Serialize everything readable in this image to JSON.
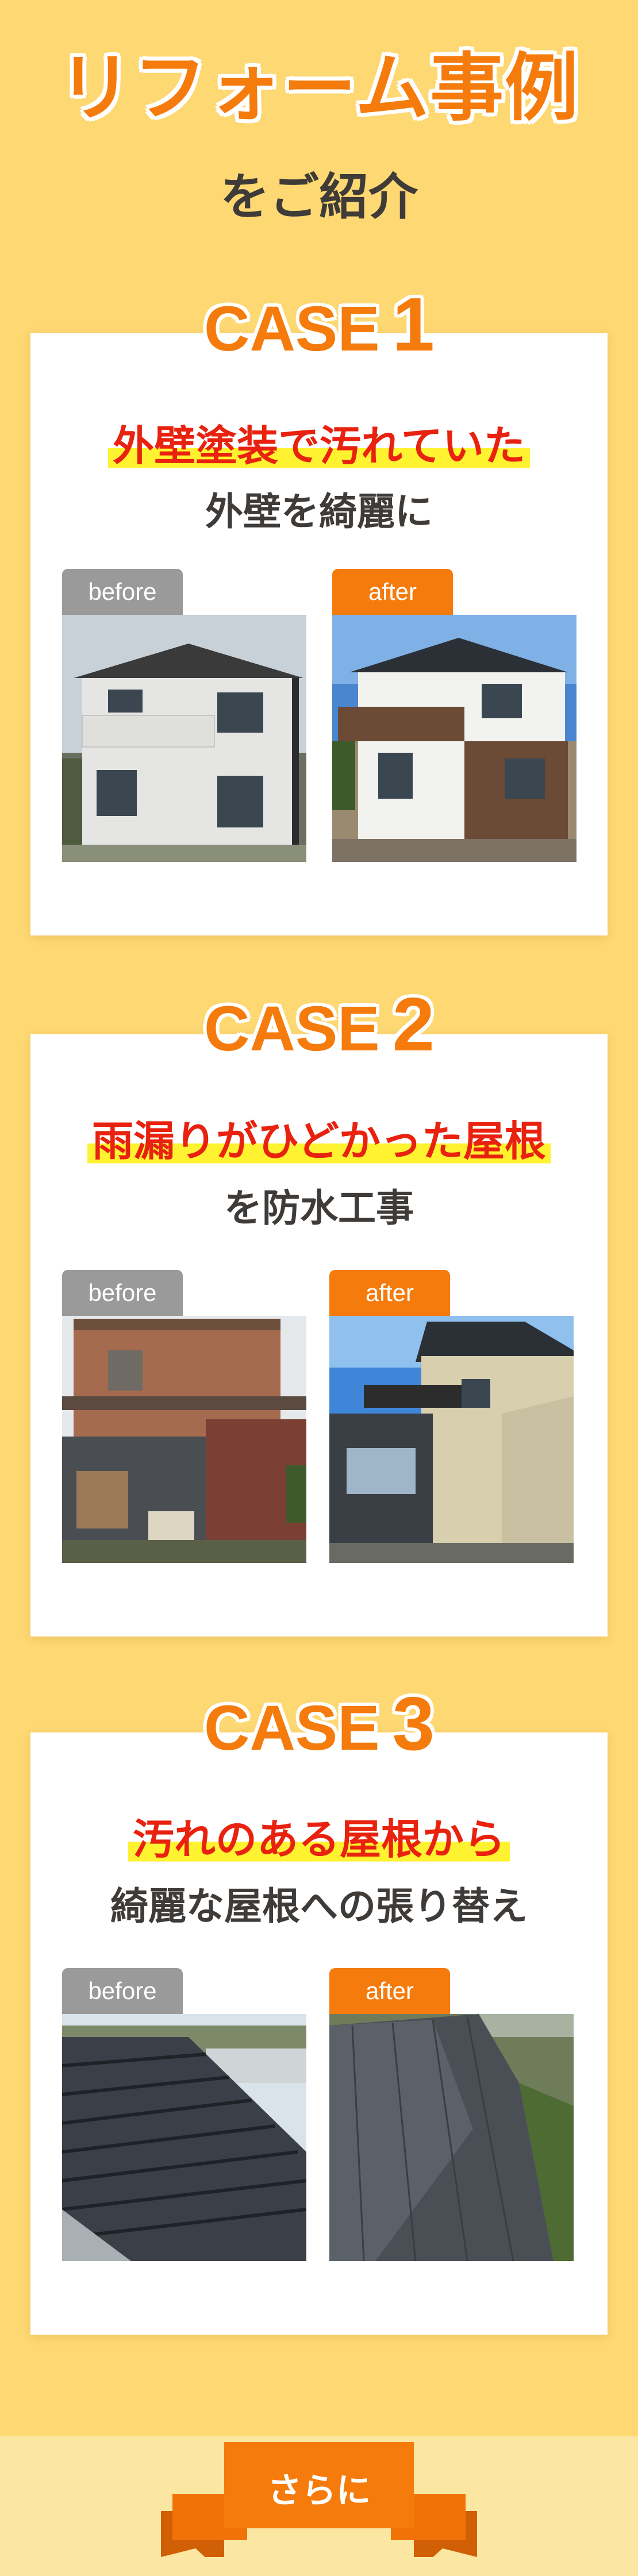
{
  "header": {
    "title": "リフォーム事例",
    "subtitle": "をご紹介"
  },
  "tags": {
    "before": "before",
    "after": "after"
  },
  "cases": [
    {
      "label": "CASE",
      "number": "1",
      "headline": "外壁塗装で汚れていた",
      "sub": "外壁を綺麗に"
    },
    {
      "label": "CASE",
      "number": "2",
      "headline": "雨漏りがひどかった屋根",
      "sub": "を防水工事"
    },
    {
      "label": "CASE",
      "number": "3",
      "headline": "汚れのある屋根から",
      "sub": "綺麗な屋根への張り替え"
    }
  ],
  "footer": {
    "label": "さらに"
  },
  "colors": {
    "accent": "#f47b0c",
    "background": "#fdd873",
    "highlight_red": "#e8220f",
    "marker_yellow": "#fff230"
  }
}
